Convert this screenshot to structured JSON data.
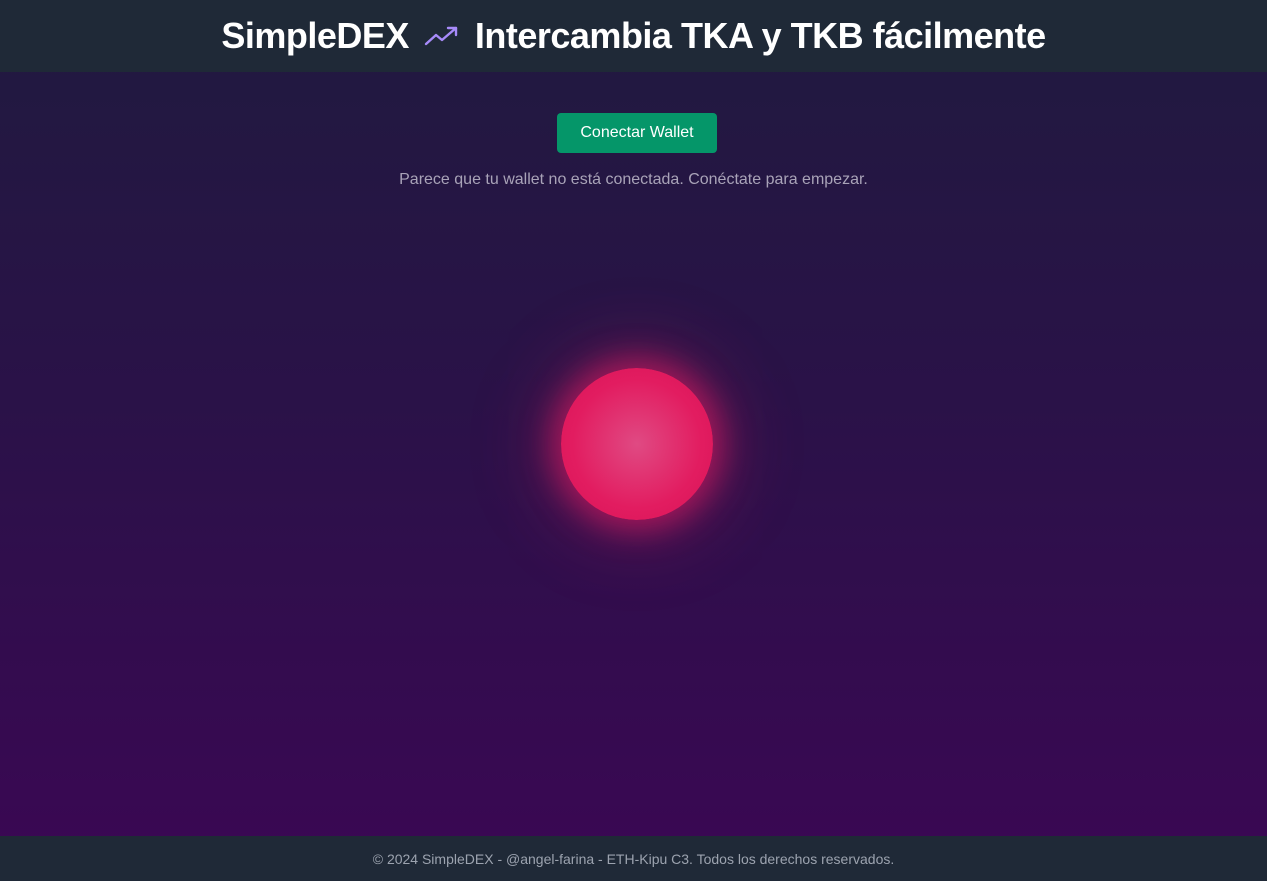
{
  "header": {
    "brand": "SimpleDEX",
    "icon": "trending-up-icon",
    "tagline": "Intercambia TKA y TKB fácilmente"
  },
  "main": {
    "connect_button_label": "Conectar Wallet",
    "hint": "Parece que tu wallet no está conectada. Conéctate para empezar."
  },
  "footer": {
    "text": "© 2024 SimpleDEX - @angel-farina - ETH-Kipu C3. Todos los derechos reservados."
  },
  "colors": {
    "header_bg": "#1f2937",
    "button_bg": "#059669",
    "icon": "#a78bfa",
    "orb": "#e21c60",
    "hint_text": "#a9a3b8",
    "footer_text": "#9ca3af"
  }
}
